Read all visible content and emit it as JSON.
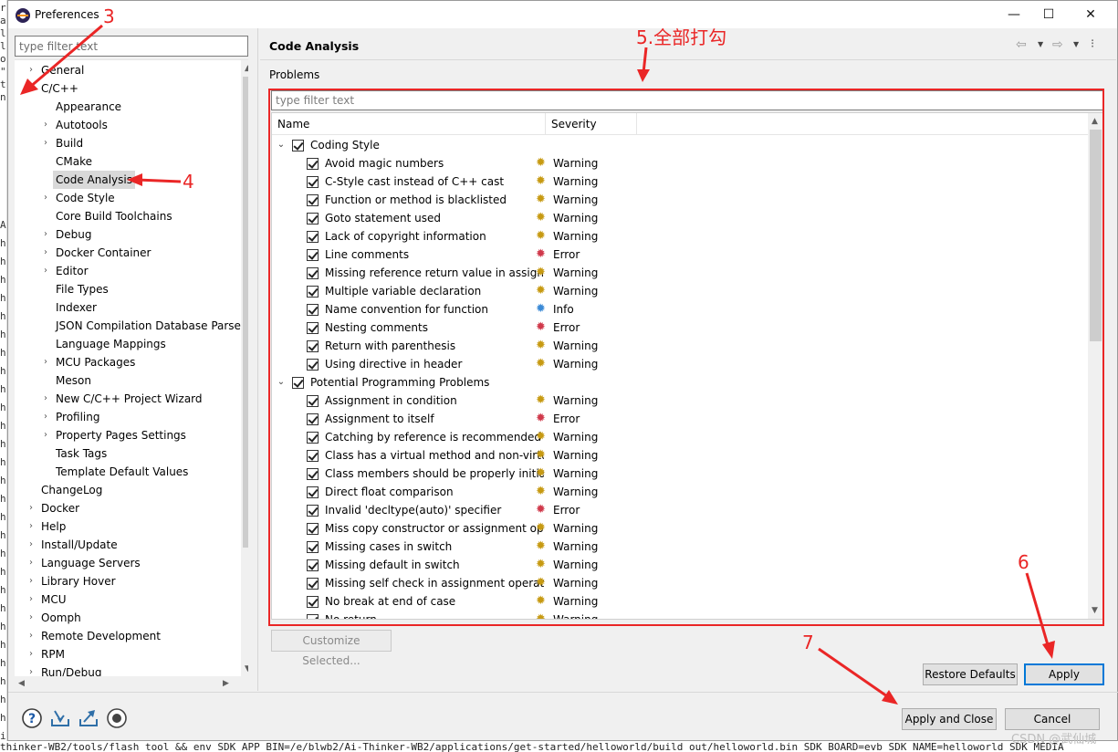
{
  "window": {
    "title": "Preferences",
    "minimize_glyph": "—",
    "maximize_glyph": "☐",
    "close_glyph": "✕"
  },
  "left_pane": {
    "filter_placeholder": "type filter text",
    "tree": [
      {
        "label": "General",
        "twisty": "›",
        "level": 0
      },
      {
        "label": "C/C++",
        "twisty": "⌄",
        "level": 0
      },
      {
        "label": "Appearance",
        "twisty": "",
        "level": 1
      },
      {
        "label": "Autotools",
        "twisty": "›",
        "level": 1
      },
      {
        "label": "Build",
        "twisty": "›",
        "level": 1
      },
      {
        "label": "CMake",
        "twisty": "",
        "level": 1
      },
      {
        "label": "Code Analysis",
        "twisty": "",
        "level": 1,
        "selected": true
      },
      {
        "label": "Code Style",
        "twisty": "›",
        "level": 1
      },
      {
        "label": "Core Build Toolchains",
        "twisty": "",
        "level": 1
      },
      {
        "label": "Debug",
        "twisty": "›",
        "level": 1
      },
      {
        "label": "Docker Container",
        "twisty": "›",
        "level": 1
      },
      {
        "label": "Editor",
        "twisty": "›",
        "level": 1
      },
      {
        "label": "File Types",
        "twisty": "",
        "level": 1
      },
      {
        "label": "Indexer",
        "twisty": "",
        "level": 1
      },
      {
        "label": "JSON Compilation Database Parse",
        "twisty": "",
        "level": 1
      },
      {
        "label": "Language Mappings",
        "twisty": "",
        "level": 1
      },
      {
        "label": "MCU Packages",
        "twisty": "›",
        "level": 1
      },
      {
        "label": "Meson",
        "twisty": "",
        "level": 1
      },
      {
        "label": "New C/C++ Project Wizard",
        "twisty": "›",
        "level": 1
      },
      {
        "label": "Profiling",
        "twisty": "›",
        "level": 1
      },
      {
        "label": "Property Pages Settings",
        "twisty": "›",
        "level": 1
      },
      {
        "label": "Task Tags",
        "twisty": "",
        "level": 1
      },
      {
        "label": "Template Default Values",
        "twisty": "",
        "level": 1
      },
      {
        "label": "ChangeLog",
        "twisty": "",
        "level": 0
      },
      {
        "label": "Docker",
        "twisty": "›",
        "level": 0
      },
      {
        "label": "Help",
        "twisty": "›",
        "level": 0
      },
      {
        "label": "Install/Update",
        "twisty": "›",
        "level": 0
      },
      {
        "label": "Language Servers",
        "twisty": "›",
        "level": 0
      },
      {
        "label": "Library Hover",
        "twisty": "›",
        "level": 0
      },
      {
        "label": "MCU",
        "twisty": "›",
        "level": 0
      },
      {
        "label": "Oomph",
        "twisty": "›",
        "level": 0
      },
      {
        "label": "Remote Development",
        "twisty": "›",
        "level": 0
      },
      {
        "label": "RPM",
        "twisty": "›",
        "level": 0
      },
      {
        "label": "Run/Debug",
        "twisty": "›",
        "level": 0
      }
    ]
  },
  "page": {
    "title": "Code Analysis",
    "section_label": "Problems",
    "filter_placeholder": "type filter text",
    "columns": {
      "name": "Name",
      "severity": "Severity"
    },
    "rows": [
      {
        "kind": "group",
        "name": "Coding Style"
      },
      {
        "kind": "item",
        "name": "Avoid magic numbers",
        "severity": "Warning"
      },
      {
        "kind": "item",
        "name": "C-Style cast instead of C++ cast",
        "severity": "Warning"
      },
      {
        "kind": "item",
        "name": "Function or method is blacklisted",
        "severity": "Warning"
      },
      {
        "kind": "item",
        "name": "Goto statement used",
        "severity": "Warning"
      },
      {
        "kind": "item",
        "name": "Lack of copyright information",
        "severity": "Warning"
      },
      {
        "kind": "item",
        "name": "Line comments",
        "severity": "Error"
      },
      {
        "kind": "item",
        "name": "Missing reference return value in assignm",
        "severity": "Warning"
      },
      {
        "kind": "item",
        "name": "Multiple variable declaration",
        "severity": "Warning"
      },
      {
        "kind": "item",
        "name": "Name convention for function",
        "severity": "Info"
      },
      {
        "kind": "item",
        "name": "Nesting comments",
        "severity": "Error"
      },
      {
        "kind": "item",
        "name": "Return with parenthesis",
        "severity": "Warning"
      },
      {
        "kind": "item",
        "name": "Using directive in header",
        "severity": "Warning"
      },
      {
        "kind": "group",
        "name": "Potential Programming Problems"
      },
      {
        "kind": "item",
        "name": "Assignment in condition",
        "severity": "Warning"
      },
      {
        "kind": "item",
        "name": "Assignment to itself",
        "severity": "Error"
      },
      {
        "kind": "item",
        "name": "Catching by reference is recommended",
        "severity": "Warning"
      },
      {
        "kind": "item",
        "name": "Class has a virtual method and non-virtua",
        "severity": "Warning"
      },
      {
        "kind": "item",
        "name": "Class members should be properly initiali",
        "severity": "Warning"
      },
      {
        "kind": "item",
        "name": "Direct float comparison",
        "severity": "Warning"
      },
      {
        "kind": "item",
        "name": "Invalid 'decltype(auto)' specifier",
        "severity": "Error"
      },
      {
        "kind": "item",
        "name": "Miss copy constructor or assignment ope",
        "severity": "Warning"
      },
      {
        "kind": "item",
        "name": "Missing cases in switch",
        "severity": "Warning"
      },
      {
        "kind": "item",
        "name": "Missing default in switch",
        "severity": "Warning"
      },
      {
        "kind": "item",
        "name": "Missing self check in assignment operator",
        "severity": "Warning"
      },
      {
        "kind": "item",
        "name": "No break at end of case",
        "severity": "Warning"
      },
      {
        "kind": "item",
        "name": "No return",
        "severity": "Warning"
      }
    ],
    "customize_button": "Customize Selected...",
    "restore_defaults_button": "Restore Defaults",
    "apply_button": "Apply"
  },
  "footer": {
    "apply_close_button": "Apply and Close",
    "cancel_button": "Cancel"
  },
  "annotations": {
    "n3": "3",
    "n4": "4",
    "n5": "5.全部打勾",
    "n6": "6",
    "n7": "7",
    "color": "#ea2626"
  },
  "background": {
    "editor_chars": [
      "r",
      "a",
      "l",
      "l",
      "o",
      "\"",
      "t",
      "n",
      "A",
      "h",
      "h",
      "h",
      "h",
      "h",
      "h",
      "h",
      "h",
      "h",
      "h",
      "h",
      "h",
      "h",
      "h",
      "h",
      "h",
      "h",
      "h",
      "h",
      "h",
      "h",
      "h",
      "h",
      "h",
      "h",
      "h",
      "h",
      "i"
    ],
    "command_line": "thinker-WB2/tools/flash_tool && env SDK_APP_BIN=/e/blwb2/Ai-Thinker-WB2/applications/get-started/helloworld/build_out/helloworld.bin SDK_BOARD=evb SDK_NAME=helloworld SDK_MEDIA",
    "watermark": "CSDN @武仙城"
  },
  "icons": {
    "help": "help-icon",
    "import": "import-icon",
    "export": "export-icon",
    "oomph": "record-icon",
    "warning_bug": "warning-bug-icon",
    "error_bug": "error-bug-icon",
    "info_bug": "info-bug-icon"
  }
}
